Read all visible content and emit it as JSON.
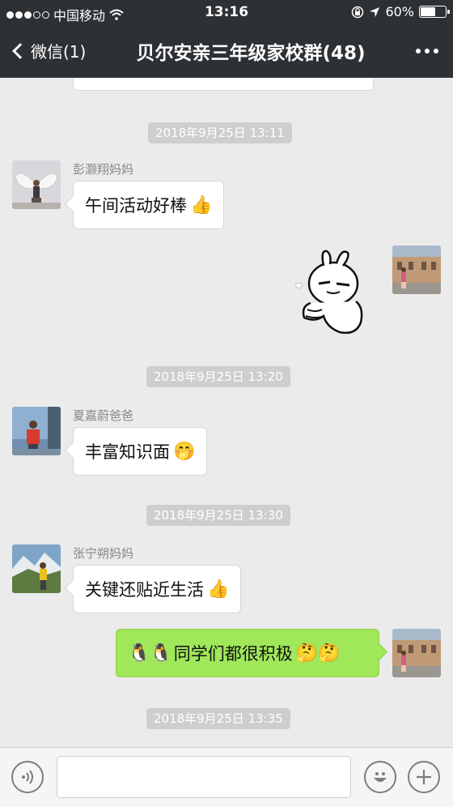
{
  "status_bar": {
    "carrier": "中国移动",
    "time": "13:16",
    "battery": "60%",
    "battery_level": 0.6
  },
  "nav": {
    "back_label": "微信(1)",
    "title": "贝尔安亲三年级家校群(48)"
  },
  "messages": {
    "ts1": "2018年9月25日 13:11",
    "m1": {
      "sender": "彭灏翔妈妈",
      "text": "午间活动好棒",
      "emoji": "👍"
    },
    "ts2": "2018年9月25日 13:20",
    "m2": {
      "sender": "夏嘉蔚爸爸",
      "text": "丰富知识面",
      "emoji": "🤭"
    },
    "ts3": "2018年9月25日 13:30",
    "m3": {
      "sender": "张宁朔妈妈",
      "text": "关键还贴近生活",
      "emoji": "👍"
    },
    "m4": {
      "prefix_emoji": "🐧🐧",
      "text": "同学们都很积极",
      "emoji": "🤔🤔"
    },
    "ts4": "2018年9月25日 13:35"
  },
  "input": {
    "placeholder": ""
  },
  "colors": {
    "nav_bg": "#2e3134",
    "chat_bg": "#ebebeb",
    "own_bubble": "#a0e75a",
    "timestamp_bg": "#cecece"
  },
  "icons": [
    "wifi-icon",
    "lock-rotation-icon",
    "location-arrow-icon",
    "battery-icon",
    "back-chevron-icon",
    "more-icon",
    "voice-icon",
    "emoji-icon",
    "plus-icon"
  ]
}
